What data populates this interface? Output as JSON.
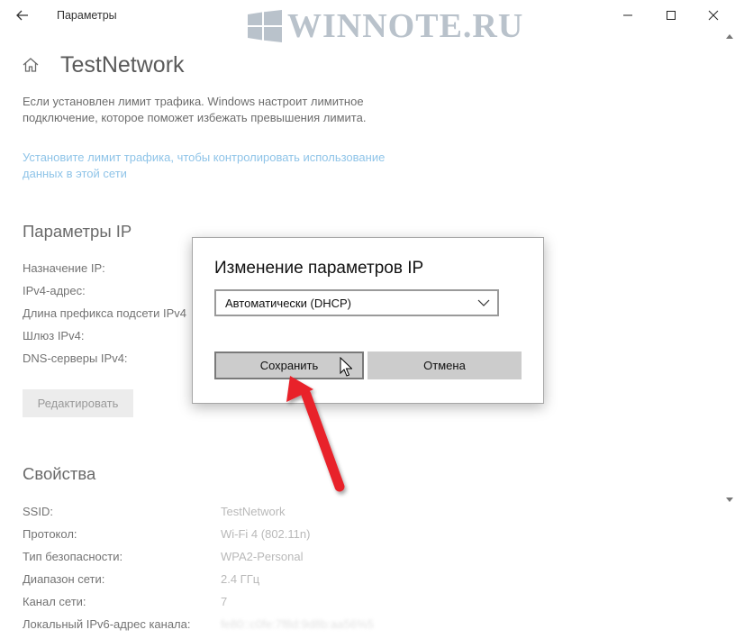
{
  "titlebar": {
    "app_title": "Параметры",
    "watermark_text": "WINNOTE.RU"
  },
  "page": {
    "title": "TestNetwork",
    "description": "Если установлен лимит трафика. Windows настроит лимитное подключение, которое поможет избежать превышения лимита.",
    "description_line1": "Если установлен лимит трафика. Windows настроит лимитное",
    "description_line2": "подключение, которое поможет избежать превышения лимита.",
    "link_line1": "Установите лимит трафика, чтобы контролировать использование",
    "link_line2": "данных в этой сети"
  },
  "ip_settings": {
    "heading": "Параметры IP",
    "labels": [
      "Назначение IP:",
      "IPv4-адрес:",
      "Длина префикса подсети IPv4",
      "Шлюз IPv4:",
      "DNS-серверы IPv4:"
    ],
    "edit_button": "Редактировать"
  },
  "properties": {
    "heading": "Свойства",
    "rows": [
      {
        "label": "SSID:",
        "value": "TestNetwork"
      },
      {
        "label": "Протокол:",
        "value": "Wi-Fi 4 (802.11n)"
      },
      {
        "label": "Тип безопасности:",
        "value": "WPA2-Personal"
      },
      {
        "label": "Диапазон сети:",
        "value": "2.4 ГГц"
      },
      {
        "label": "Канал сети:",
        "value": "7"
      },
      {
        "label": "Локальный IPv6-адрес канала:",
        "value": "fe80::c0fe:7f8d:9d8b:aa56%5"
      }
    ]
  },
  "dialog": {
    "title": "Изменение параметров IP",
    "select_value": "Автоматически (DHCP)",
    "save_button": "Сохранить",
    "cancel_button": "Отмена"
  },
  "colors": {
    "accent_arrow": "#e8202a",
    "link": "#8fc4e8",
    "button_bg": "#cccccc"
  }
}
